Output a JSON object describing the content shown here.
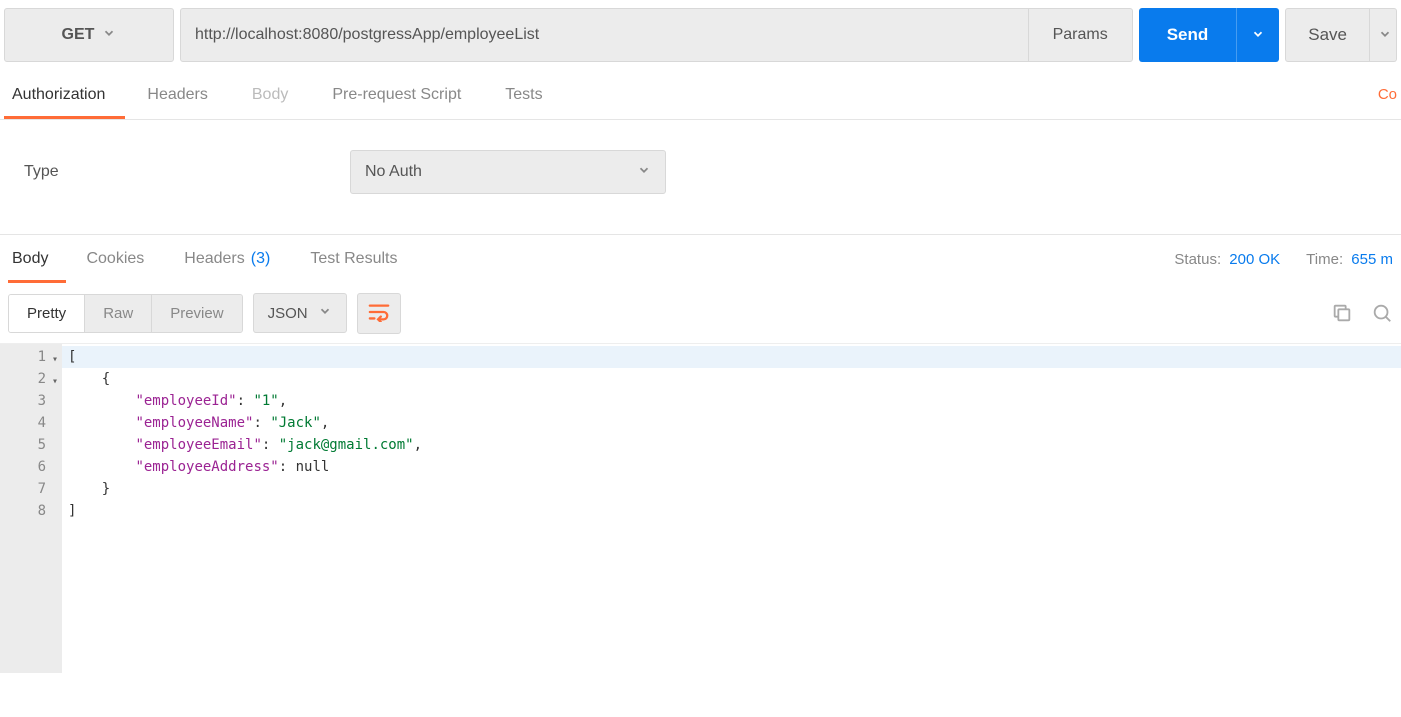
{
  "request": {
    "method": "GET",
    "url": "http://localhost:8080/postgressApp/employeeList",
    "params_label": "Params",
    "send_label": "Send",
    "save_label": "Save"
  },
  "req_tabs": {
    "authorization": "Authorization",
    "headers": "Headers",
    "body": "Body",
    "prerequest": "Pre-request Script",
    "tests": "Tests",
    "code": "Co"
  },
  "auth": {
    "type_label": "Type",
    "selected": "No Auth"
  },
  "resp_tabs": {
    "body": "Body",
    "cookies": "Cookies",
    "headers": "Headers",
    "headers_count": "(3)",
    "tests": "Test Results"
  },
  "status": {
    "status_label": "Status:",
    "status_value": "200 OK",
    "time_label": "Time:",
    "time_value": "655 m"
  },
  "resp_view": {
    "pretty": "Pretty",
    "raw": "Raw",
    "preview": "Preview",
    "format": "JSON"
  },
  "response_body": [
    {
      "n": 1,
      "fold": true,
      "indent": 0,
      "text": "["
    },
    {
      "n": 2,
      "fold": true,
      "indent": 1,
      "text": "{"
    },
    {
      "n": 3,
      "indent": 2,
      "key": "employeeId",
      "value": "1",
      "type": "string",
      "comma": true
    },
    {
      "n": 4,
      "indent": 2,
      "key": "employeeName",
      "value": "Jack",
      "type": "string",
      "comma": true
    },
    {
      "n": 5,
      "indent": 2,
      "key": "employeeEmail",
      "value": "jack@gmail.com",
      "type": "string",
      "comma": true
    },
    {
      "n": 6,
      "indent": 2,
      "key": "employeeAddress",
      "value": "null",
      "type": "null",
      "comma": false
    },
    {
      "n": 7,
      "indent": 1,
      "text": "}"
    },
    {
      "n": 8,
      "indent": 0,
      "text": "]"
    }
  ]
}
